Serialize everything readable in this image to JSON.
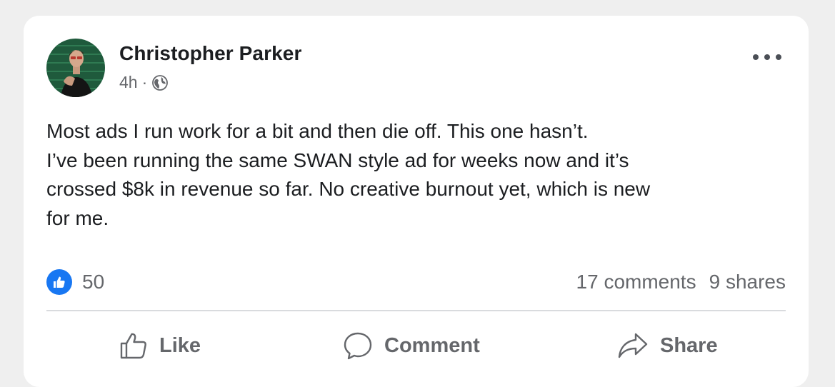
{
  "post": {
    "author": "Christopher Parker",
    "time": "4h",
    "separator": "·",
    "privacy_icon": "globe-icon",
    "more_icon": "more-horizontal-icon",
    "text_lines": [
      "Most ads I run work for a bit and then die off. This one hasn’t.",
      "I’ve been running the same SWAN style ad for weeks now and it’s",
      "crossed $8k in revenue so far. No creative burnout yet, which is new",
      "for me."
    ]
  },
  "stats": {
    "reaction_icon": "like-reaction-icon",
    "reactions": "50",
    "comments": "17 comments",
    "shares": "9 shares"
  },
  "actions": {
    "like": "Like",
    "comment": "Comment",
    "share": "Share"
  },
  "colors": {
    "accent": "#1877f2",
    "muted_text": "#65676b",
    "primary_text": "#1c1e21",
    "background": "#efefef",
    "card": "#ffffff"
  }
}
